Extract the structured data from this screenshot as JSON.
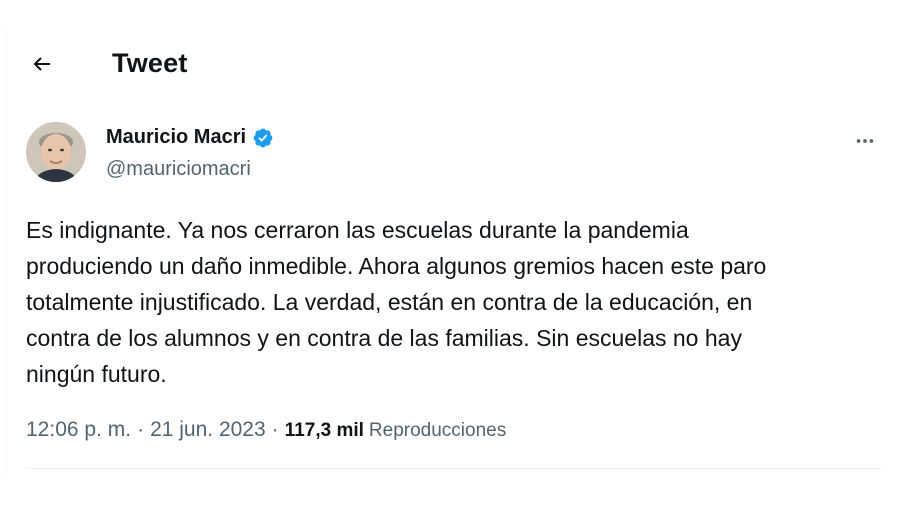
{
  "header": {
    "title": "Tweet",
    "back_icon": "arrow-left-icon"
  },
  "author": {
    "name": "Mauricio Macri",
    "handle": "@mauriciomacri",
    "verified_icon": "verified-badge-icon",
    "verified_color": "#1d9bf0",
    "more_icon": "more-horizontal-icon"
  },
  "tweet": {
    "lines": [
      "Es indignante. Ya nos cerraron las escuelas durante la pandemia",
      "produciendo un daño inmedible. Ahora algunos gremios hacen este paro",
      "totalmente injustificado. La verdad, están en contra de la educación, en",
      "contra de los alumnos y en contra de las familias. Sin escuelas no hay",
      "ningún futuro."
    ]
  },
  "meta": {
    "time": "12:06 p. m.",
    "separator": "·",
    "date": "21 jun. 2023",
    "views_count": "117,3 mil",
    "views_label": "Reproducciones"
  },
  "colors": {
    "text": "#0f1419",
    "secondary": "#536471",
    "divider": "#eff3f4"
  }
}
